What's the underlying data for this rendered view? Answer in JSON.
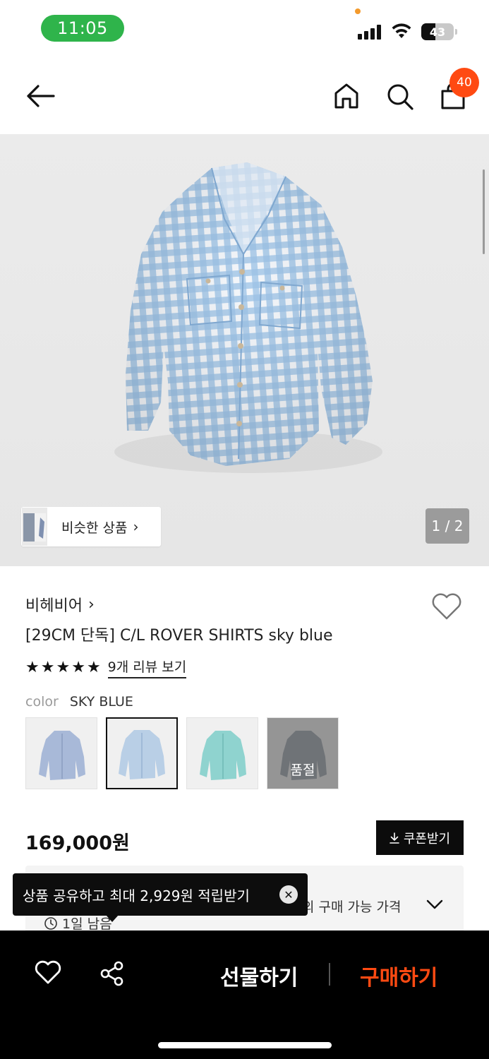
{
  "status_bar": {
    "time": "11:05",
    "battery": "43",
    "battery_level": 0.43
  },
  "nav": {
    "cart_count": "40"
  },
  "gallery": {
    "similar_label": "비슷한 상품",
    "page_indicator": "1 / 2"
  },
  "product": {
    "brand": "비헤비어",
    "title": "[29CM 단독] C/L ROVER SHIRTS sky blue",
    "rating_stars": 5,
    "review_link": "9개 리뷰 보기",
    "color_label": "color",
    "color_value": "SKY BLUE",
    "swatches": [
      {
        "color": "#a8b9d8",
        "sold_out": false
      },
      {
        "color": "#b9cfe6",
        "sold_out": false,
        "selected": true
      },
      {
        "color": "#8fd3cf",
        "sold_out": false
      },
      {
        "color": "#566476",
        "sold_out": true,
        "sold_out_label": "품절"
      }
    ],
    "price": "169,000원",
    "coupon_label": "쿠폰받기"
  },
  "benefit": {
    "text": "의 구매 가능 가격",
    "timer": "1일 남음"
  },
  "tooltip": {
    "text": "상품 공유하고 최대 2,929원 적립받기"
  },
  "bottom_bar": {
    "gift_label": "선물하기",
    "buy_label": "구매하기"
  },
  "colors": {
    "accent": "#ff4a12",
    "status_pill": "#2fb44b"
  }
}
